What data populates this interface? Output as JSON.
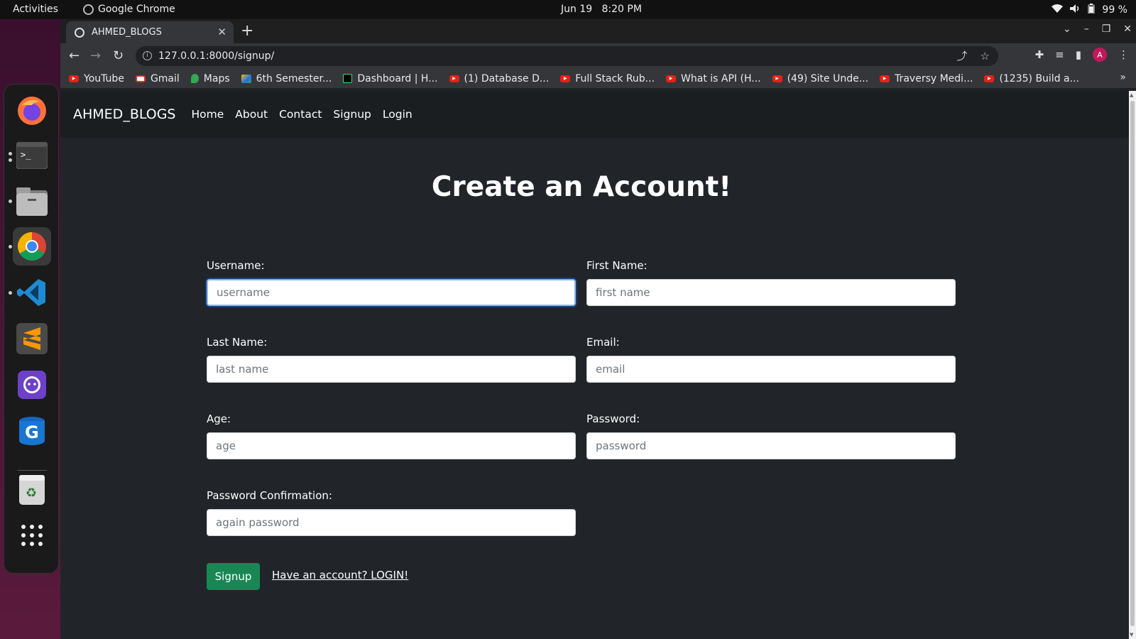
{
  "topbar": {
    "activities": "Activities",
    "app": "Google Chrome",
    "date": "Jun 19",
    "time": "8:20 PM",
    "battery": "99 %"
  },
  "dock": {
    "apps": [
      "firefox-icon",
      "terminal-icon",
      "files-icon",
      "chrome-icon",
      "vscode-icon",
      "sublime-icon",
      "github-desktop-icon",
      "gdrive-icon",
      "trash-icon",
      "app-grid-icon"
    ]
  },
  "browser": {
    "tab_title": "AHMED_BLOGS",
    "url": "127.0.0.1:8000/signup/",
    "bookmarks": [
      {
        "label": "YouTube",
        "icon": "youtube"
      },
      {
        "label": "Gmail",
        "icon": "gmail"
      },
      {
        "label": "Maps",
        "icon": "maps"
      },
      {
        "label": "6th Semester...",
        "icon": "drive"
      },
      {
        "label": "Dashboard | H...",
        "icon": "hackerrank"
      },
      {
        "label": "(1) Database D...",
        "icon": "youtube"
      },
      {
        "label": "Full Stack Rub...",
        "icon": "youtube"
      },
      {
        "label": "What is API (H...",
        "icon": "youtube"
      },
      {
        "label": "(49) Site Unde...",
        "icon": "youtube"
      },
      {
        "label": "Traversy Medi...",
        "icon": "youtube"
      },
      {
        "label": "(1235) Build a...",
        "icon": "youtube"
      }
    ],
    "avatar_letter": "A"
  },
  "site": {
    "brand": "AHMED_BLOGS",
    "nav": [
      "Home",
      "About",
      "Contact",
      "Signup",
      "Login"
    ],
    "heading": "Create an Account!",
    "fields": {
      "username": {
        "label": "Username:",
        "placeholder": "username",
        "value": ""
      },
      "first_name": {
        "label": "First Name:",
        "placeholder": "first name",
        "value": ""
      },
      "last_name": {
        "label": "Last Name:",
        "placeholder": "last name",
        "value": ""
      },
      "email": {
        "label": "Email:",
        "placeholder": "email",
        "value": ""
      },
      "age": {
        "label": "Age:",
        "placeholder": "age",
        "value": ""
      },
      "password": {
        "label": "Password:",
        "placeholder": "password",
        "value": ""
      },
      "password_confirm": {
        "label": "Password Confirmation:",
        "placeholder": "again password",
        "value": ""
      }
    },
    "submit_label": "Signup",
    "login_link": "Have an account? LOGIN!"
  },
  "colors": {
    "page_bg": "#212529",
    "navbar_bg": "#1b1e21",
    "button_green": "#198754",
    "avatar": "#c2185b"
  }
}
